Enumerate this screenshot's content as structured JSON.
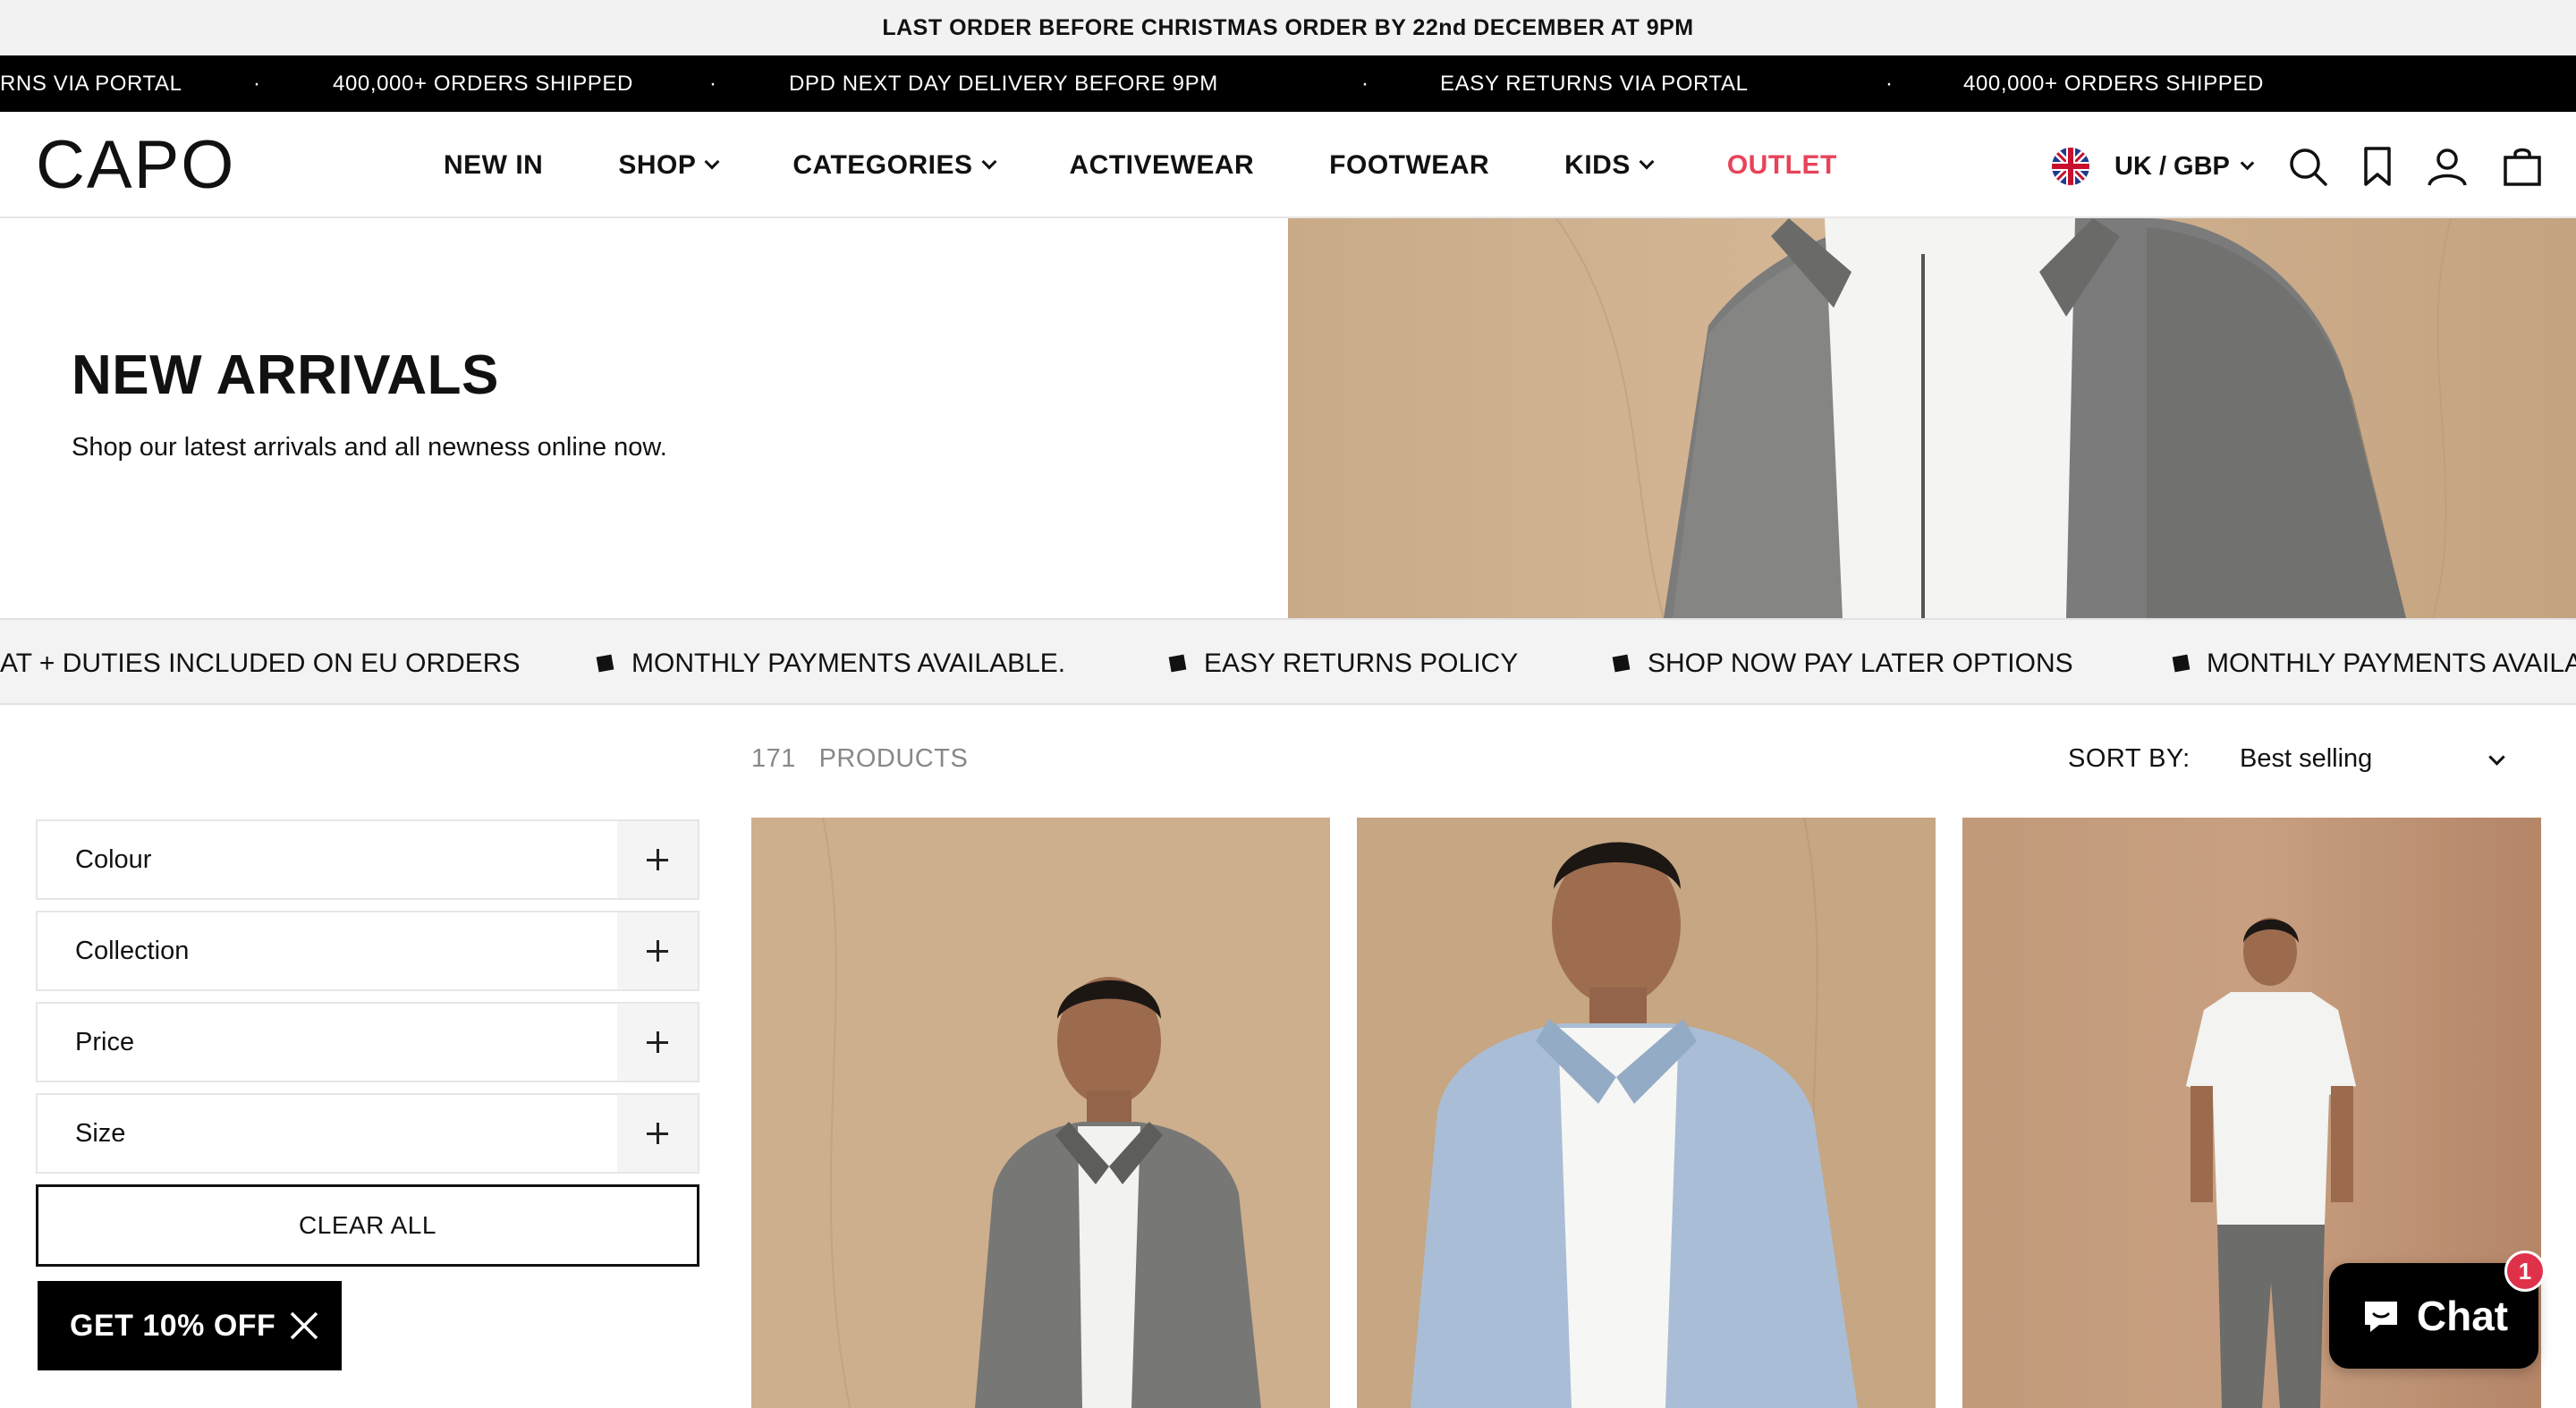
{
  "announcement": "LAST ORDER BEFORE CHRISTMAS ORDER BY 22nd DECEMBER AT 9PM",
  "ticker": [
    "RNS VIA PORTAL",
    "400,000+ ORDERS SHIPPED",
    "DPD NEXT DAY DELIVERY BEFORE 9PM",
    "EASY RETURNS VIA PORTAL",
    "400,000+ ORDERS SHIPPED"
  ],
  "ticker_separator": "·",
  "header": {
    "logo": "CAPO",
    "nav": [
      {
        "label": "NEW IN",
        "has_dropdown": false
      },
      {
        "label": "SHOP",
        "has_dropdown": true
      },
      {
        "label": "CATEGORIES",
        "has_dropdown": true
      },
      {
        "label": "ACTIVEWEAR",
        "has_dropdown": false
      },
      {
        "label": "FOOTWEAR",
        "has_dropdown": false
      },
      {
        "label": "KIDS",
        "has_dropdown": true
      },
      {
        "label": "OUTLET",
        "has_dropdown": false,
        "color": "#e8435a"
      }
    ],
    "currency": "UK / GBP",
    "icons": [
      "search-icon",
      "bookmark-icon",
      "account-icon",
      "bag-icon"
    ]
  },
  "hero": {
    "title": "NEW ARRIVALS",
    "subtitle": "Shop our latest arrivals and all newness online now."
  },
  "benefits": [
    "AT + DUTIES INCLUDED ON EU ORDERS",
    "MONTHLY PAYMENTS AVAILABLE.",
    "EASY RETURNS POLICY",
    "SHOP NOW PAY LATER OPTIONS",
    "MONTHLY PAYMENTS AVAILA"
  ],
  "filters": [
    {
      "label": "Colour"
    },
    {
      "label": "Collection"
    },
    {
      "label": "Price"
    },
    {
      "label": "Size"
    }
  ],
  "clear_all": "CLEAR ALL",
  "promo": "GET 10% OFF",
  "products": {
    "count": "171",
    "count_label": "PRODUCTS",
    "sort_label": "SORT BY:",
    "sort_value": "Best selling"
  },
  "chat": {
    "label": "Chat",
    "badge": "1"
  },
  "colors": {
    "outlet": "#e8435a",
    "badge": "#e0314b",
    "ticker_bg": "#000000"
  }
}
